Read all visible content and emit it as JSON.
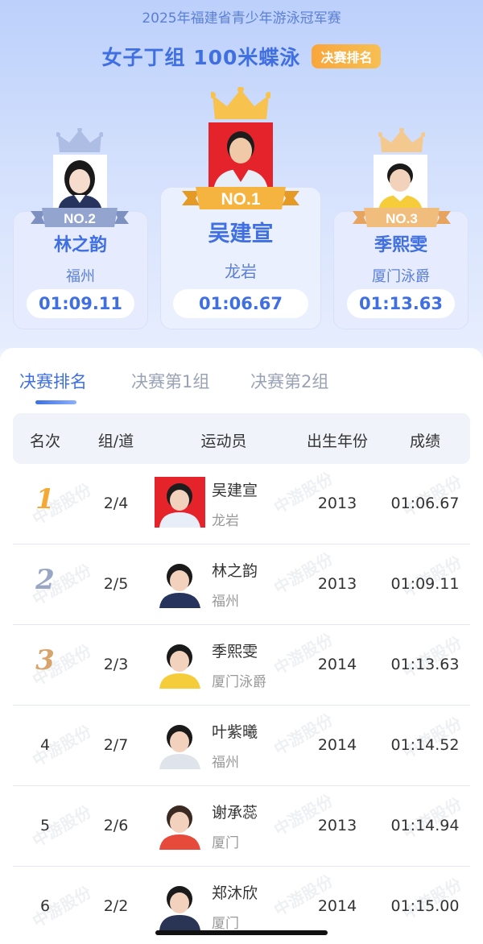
{
  "header": {
    "event_name": "2025年福建省青少年游泳冠军赛",
    "title": "女子丁组 100米蝶泳",
    "badge": "决赛排名"
  },
  "podium": [
    {
      "place_label": "NO.1",
      "name": "吴建宣",
      "team": "龙岩",
      "time": "01:06.67",
      "ribbon_color": "#f5b33f",
      "crown_color": "#f7c04f",
      "photo_bg": "#e4232b"
    },
    {
      "place_label": "NO.2",
      "name": "林之韵",
      "team": "福州",
      "time": "01:09.11",
      "ribbon_color": "#93a4cf",
      "crown_color": "#a8b6de",
      "photo_bg": "#ffffff"
    },
    {
      "place_label": "NO.3",
      "name": "季熙雯",
      "team": "厦门泳爵",
      "time": "01:13.63",
      "ribbon_color": "#f1bd7c",
      "crown_color": "#f4c98f",
      "photo_bg": "#ffffff"
    }
  ],
  "tabs": [
    {
      "label": "决赛排名",
      "active": true
    },
    {
      "label": "决赛第1组",
      "active": false
    },
    {
      "label": "决赛第2组",
      "active": false
    }
  ],
  "table": {
    "headers": [
      "名次",
      "组/道",
      "运动员",
      "出生年份",
      "成绩"
    ],
    "rows": [
      {
        "rank": "1",
        "lane": "2/4",
        "name": "吴建宣",
        "team": "龙岩",
        "birth": "2013",
        "time": "01:06.67",
        "medal_color": "#f5a834",
        "photo_bg": "#e4232b",
        "shirt": "#e8eef8",
        "hair": "#1d1d1d"
      },
      {
        "rank": "2",
        "lane": "2/5",
        "name": "林之韵",
        "team": "福州",
        "birth": "2013",
        "time": "01:09.11",
        "medal_color": "#9aa7c4",
        "photo_bg": "#ffffff",
        "shirt": "#26345e",
        "hair": "#1a1a1a"
      },
      {
        "rank": "3",
        "lane": "2/3",
        "name": "季熙雯",
        "team": "厦门泳爵",
        "birth": "2014",
        "time": "01:13.63",
        "medal_color": "#d8a46c",
        "photo_bg": "#ffffff",
        "shirt": "#f5cd3a",
        "hair": "#1a1a1a"
      },
      {
        "rank": "4",
        "lane": "2/7",
        "name": "叶紫曦",
        "team": "福州",
        "birth": "2014",
        "time": "01:14.52",
        "medal_color": "",
        "photo_bg": "#ffffff",
        "shirt": "#dfe3ea",
        "hair": "#1a1a1a"
      },
      {
        "rank": "5",
        "lane": "2/6",
        "name": "谢承蕊",
        "team": "厦门",
        "birth": "2013",
        "time": "01:14.94",
        "medal_color": "",
        "photo_bg": "#ffffff",
        "shirt": "#e64a3b",
        "hair": "#3a2a22"
      },
      {
        "rank": "6",
        "lane": "2/2",
        "name": "郑沐欣",
        "team": "厦门",
        "birth": "2014",
        "time": "01:15.00",
        "medal_color": "",
        "photo_bg": "#ffffff",
        "shirt": "#2a3556",
        "hair": "#1a1a1a"
      }
    ]
  },
  "watermark": "中游股份"
}
